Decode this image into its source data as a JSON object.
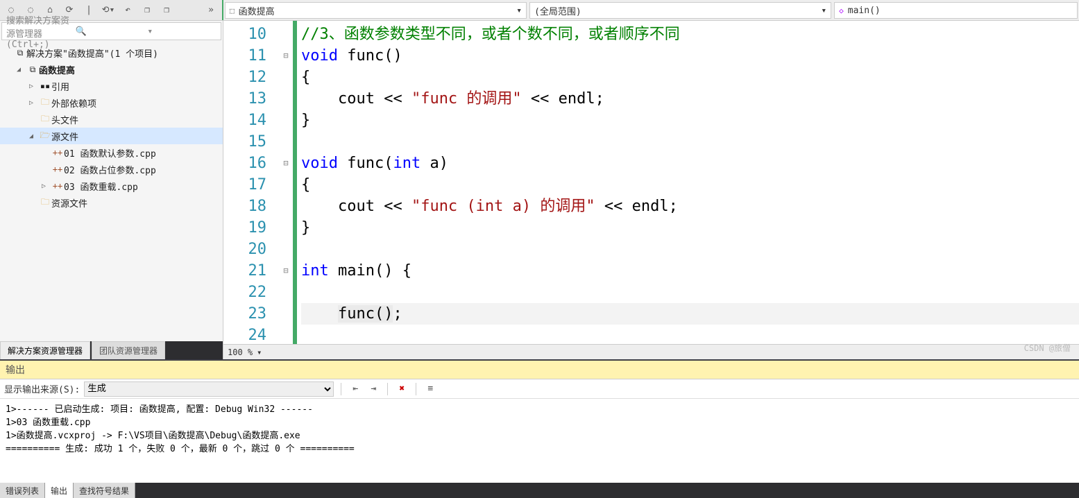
{
  "topbar": {
    "combo1": "函数提高",
    "combo2": "(全局范围)",
    "combo3": "main()"
  },
  "search": {
    "placeholder": "搜索解决方案资源管理器(Ctrl+;)"
  },
  "solution": {
    "root": "解决方案\"函数提高\"(1 个项目)",
    "project": "函数提高",
    "refs": "引用",
    "ext": "外部依赖项",
    "headers": "头文件",
    "sources": "源文件",
    "files": [
      "01 函数默认参数.cpp",
      "02 函数占位参数.cpp",
      "03 函数重载.cpp"
    ],
    "resources": "资源文件"
  },
  "sidebar_tabs": {
    "a": "解决方案资源管理器",
    "b": "团队资源管理器"
  },
  "code": {
    "lines": [
      {
        "n": 10,
        "mark": "",
        "html": "<span class='c-comment'>//3、函数参数类型不同，或者个数不同，或者顺序不同</span>"
      },
      {
        "n": 11,
        "mark": "⊟",
        "html": "<span class='c-kw'>void</span> func()"
      },
      {
        "n": 12,
        "mark": "",
        "html": "{"
      },
      {
        "n": 13,
        "mark": "",
        "html": "    cout &lt;&lt; <span class='c-str'>\"func 的调用\"</span> &lt;&lt; endl;"
      },
      {
        "n": 14,
        "mark": "",
        "html": "}"
      },
      {
        "n": 15,
        "mark": "",
        "html": ""
      },
      {
        "n": 16,
        "mark": "⊟",
        "html": "<span class='c-kw'>void</span> func(<span class='c-kw'>int</span> a)"
      },
      {
        "n": 17,
        "mark": "",
        "html": "{"
      },
      {
        "n": 18,
        "mark": "",
        "html": "    cout &lt;&lt; <span class='c-str'>\"func (int a) 的调用\"</span> &lt;&lt; endl;"
      },
      {
        "n": 19,
        "mark": "",
        "html": "}"
      },
      {
        "n": 20,
        "mark": "",
        "html": ""
      },
      {
        "n": 21,
        "mark": "⊟",
        "html": "<span class='c-kw'>int</span> main() {"
      },
      {
        "n": 22,
        "mark": "",
        "html": ""
      },
      {
        "n": 23,
        "mark": "",
        "html": "    <span class='hl'>func()</span>;",
        "cursor": true
      },
      {
        "n": 24,
        "mark": "",
        "html": ""
      }
    ]
  },
  "zoom": "100 %",
  "output": {
    "title": "输出",
    "source_label": "显示输出来源(S):",
    "source_value": "生成",
    "body": "1>------ 已启动生成: 项目: 函数提高, 配置: Debug Win32 ------\n1>03 函数重载.cpp\n1>函数提高.vcxproj -> F:\\VS项目\\函数提高\\Debug\\函数提高.exe\n========== 生成: 成功 1 个，失败 0 个，最新 0 个，跳过 0 个 ==========\n"
  },
  "output_tabs": {
    "a": "错误列表",
    "b": "输出",
    "c": "查找符号结果"
  },
  "watermark": "CSDN @旅僧"
}
